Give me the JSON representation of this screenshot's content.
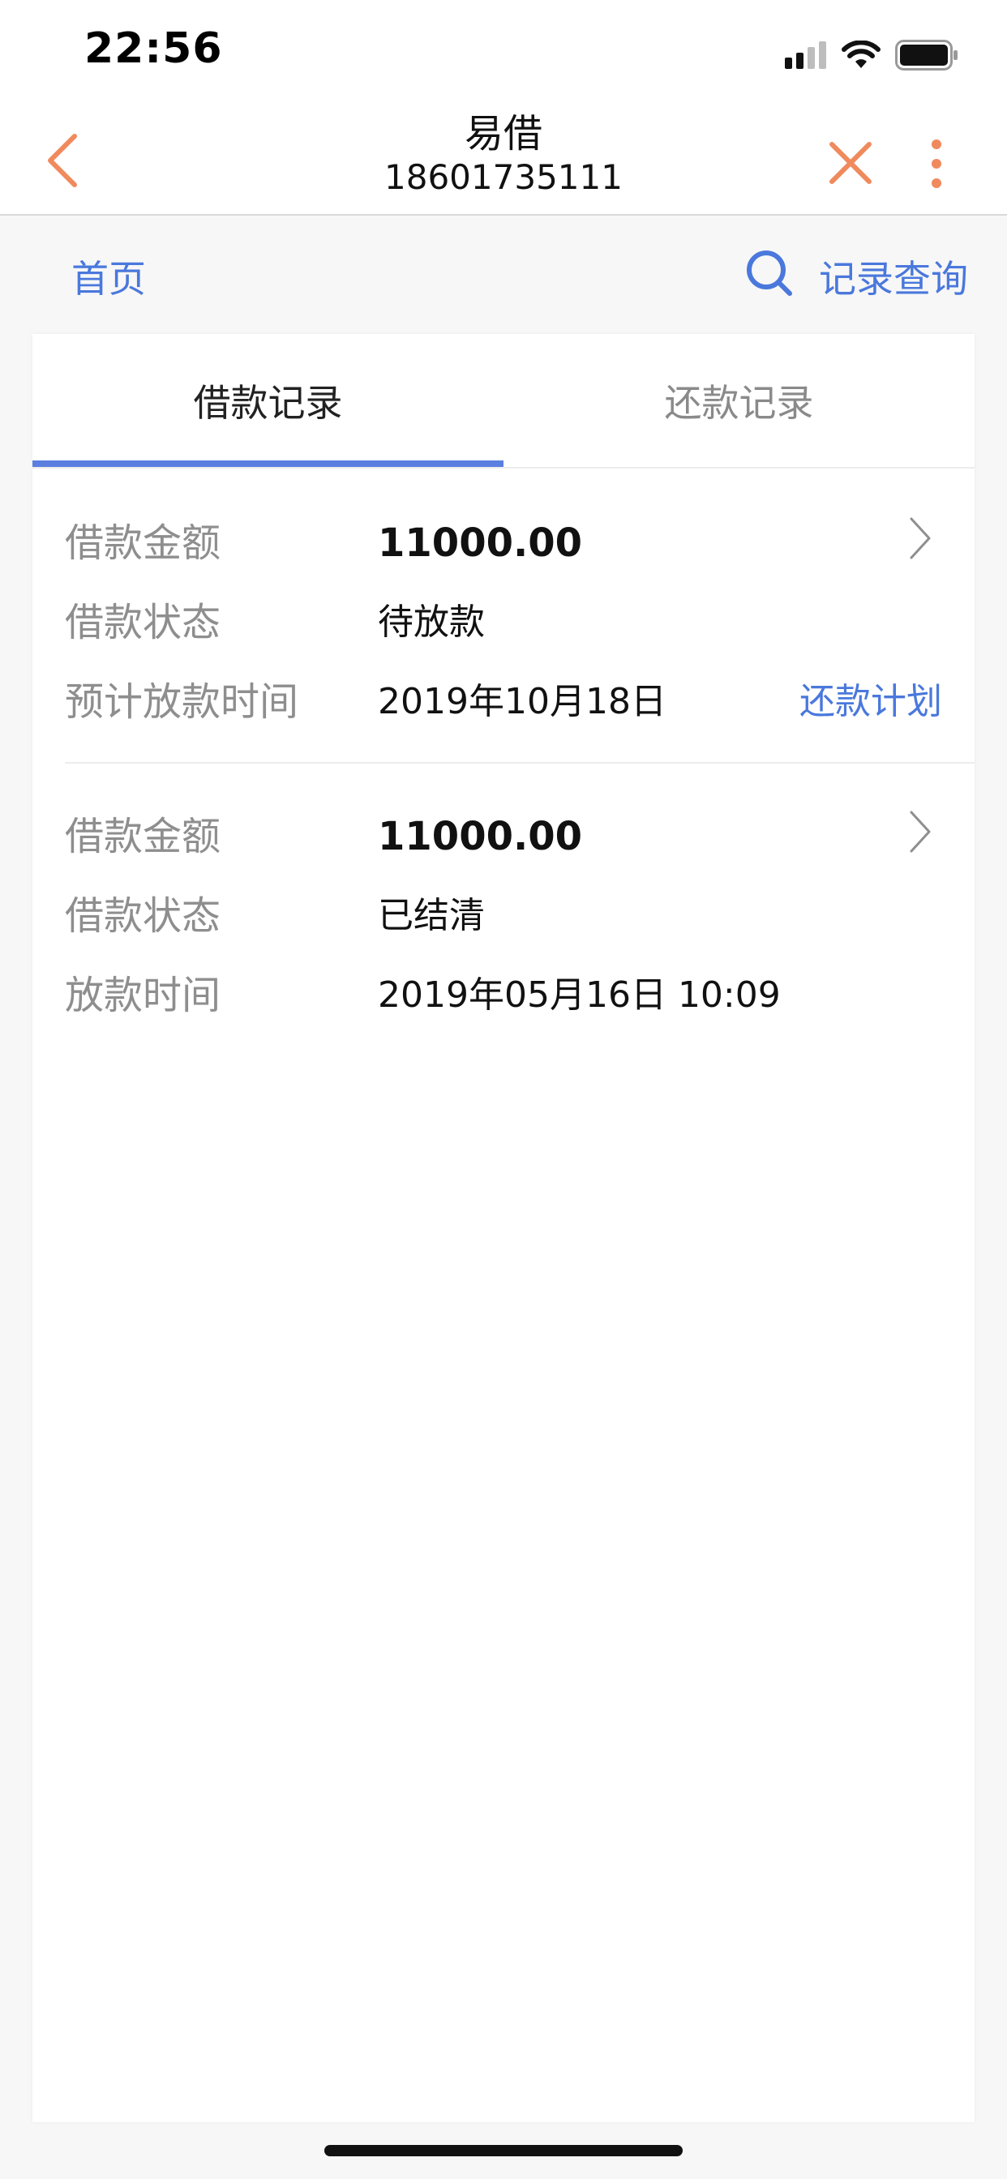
{
  "status_bar": {
    "time": "22:56"
  },
  "nav": {
    "title": "易借",
    "subtitle": "18601735111"
  },
  "sub_header": {
    "home_label": "首页",
    "query_label": "记录查询"
  },
  "tabs": [
    {
      "label": "借款记录",
      "active": true
    },
    {
      "label": "还款记录",
      "active": false
    }
  ],
  "records": [
    {
      "amount_label": "借款金额",
      "amount_value": "11000.00",
      "status_label": "借款状态",
      "status_value": "待放款",
      "time_label": "预计放款时间",
      "time_value": "2019年10月18日",
      "action_label": "还款计划"
    },
    {
      "amount_label": "借款金额",
      "amount_value": "11000.00",
      "status_label": "借款状态",
      "status_value": "已结清",
      "time_label": "放款时间",
      "time_value": "2019年05月16日 10:09"
    }
  ],
  "colors": {
    "accent": "#5b7fe0",
    "link": "#4a78dc",
    "nav_icon": "#f08a5d"
  },
  "icons": {
    "back": "chevron-left-icon",
    "close": "close-icon",
    "more": "more-vertical-icon",
    "search": "search-icon",
    "row_arrow": "chevron-right-icon"
  }
}
